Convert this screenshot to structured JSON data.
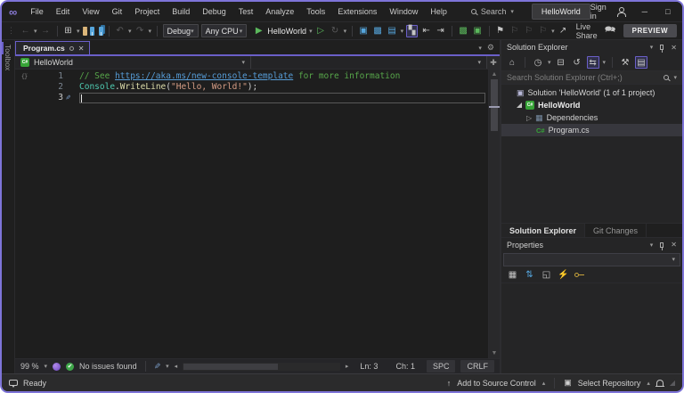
{
  "colors": {
    "accent": "#6A5FC8",
    "window_border": "#7E74D8",
    "titlebar_bg": "#1f1f1f",
    "toolbar_bg": "#1f1f1f",
    "editor_bg": "#1e1e1e",
    "panel_bg": "#252526",
    "selected_row": "#37373D",
    "statusbar_bg": "#2b2b2c",
    "comment": "#57A64A",
    "link": "#569CD6",
    "type": "#4EC9B0",
    "method": "#DCDCAA",
    "string": "#D69D85",
    "plain": "#D4D4D4",
    "run_green": "#5BB85C",
    "folder": "#DCB67A",
    "save_blue": "#55A5DC",
    "csharp_green": "#37A437",
    "key_gold": "#C8A43C"
  },
  "title_bar": {
    "menu": [
      "File",
      "Edit",
      "View",
      "Git",
      "Project",
      "Build",
      "Debug",
      "Test",
      "Analyze",
      "Tools",
      "Extensions",
      "Window",
      "Help"
    ],
    "search_label": "Search",
    "solution_badge": "HelloWorld",
    "sign_in_label": "Sign in"
  },
  "toolbar": {
    "configuration": "Debug",
    "platform": "Any CPU",
    "start_label": "HelloWorld",
    "live_share_label": "Live Share",
    "preview_label": "PREVIEW"
  },
  "editor": {
    "toolbox_label": "Toolbox",
    "tab_label": "Program.cs",
    "nav_project": "HelloWorld",
    "lines": [
      {
        "num": 1,
        "margin_icon": "file-health-icon",
        "segments": [
          {
            "text": "// See ",
            "style": "comment"
          },
          {
            "text": "https://aka.ms/new-console-template",
            "style": "link"
          },
          {
            "text": " for more information",
            "style": "comment"
          }
        ]
      },
      {
        "num": 2,
        "segments": [
          {
            "text": "Console",
            "style": "type"
          },
          {
            "text": ".",
            "style": "plain"
          },
          {
            "text": "WriteLine",
            "style": "method"
          },
          {
            "text": "(",
            "style": "plain"
          },
          {
            "text": "\"Hello, World!\"",
            "style": "string"
          },
          {
            "text": ");",
            "style": "plain"
          }
        ]
      },
      {
        "num": 3,
        "current": true,
        "gutter_icon": "pen-icon",
        "segments": []
      }
    ],
    "status": {
      "zoom_level": "99 %",
      "issues": "No issues found",
      "line": "Ln: 3",
      "column": "Ch: 1",
      "spaces": "SPC",
      "line_endings": "CRLF"
    }
  },
  "solution_explorer": {
    "title": "Solution Explorer",
    "search_placeholder": "Search Solution Explorer (Ctrl+;)",
    "tree": [
      {
        "label": "Solution 'HelloWorld' (1 of 1 project)",
        "icon": "solution-icon",
        "indent": 0,
        "expander": "none",
        "bold": false,
        "selected": false
      },
      {
        "label": "HelloWorld",
        "icon": "csharp-project-icon",
        "indent": 1,
        "expander": "expanded",
        "bold": true,
        "selected": false
      },
      {
        "label": "Dependencies",
        "icon": "dependencies-icon",
        "indent": 2,
        "expander": "collapsed",
        "bold": false,
        "selected": false
      },
      {
        "label": "Program.cs",
        "icon": "csharp-file-icon",
        "indent": 2,
        "expander": "none",
        "bold": false,
        "selected": true
      }
    ],
    "tabs": [
      {
        "label": "Solution Explorer",
        "active": true
      },
      {
        "label": "Git Changes",
        "active": false
      }
    ]
  },
  "properties_panel": {
    "title": "Properties"
  },
  "status_bar": {
    "message": "Ready",
    "add_to_source_control": "Add to Source Control",
    "select_repository": "Select Repository"
  }
}
